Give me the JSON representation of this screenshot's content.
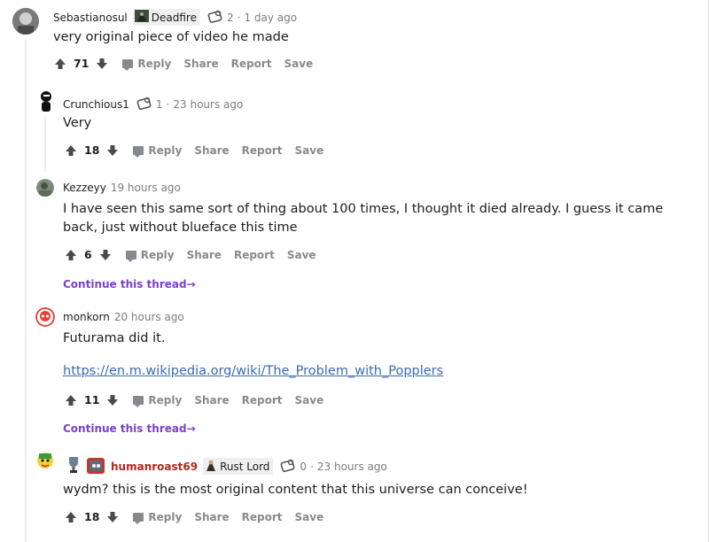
{
  "comments": [
    {
      "author": "Sebastianosul",
      "flair": "Deadfire",
      "award_count": "2",
      "time": "1 day ago",
      "body": "very original piece of video he made",
      "score": "71"
    },
    {
      "author": "Crunchious1",
      "award_count": "1",
      "time": "23 hours ago",
      "body": "Very",
      "score": "18"
    },
    {
      "author": "Kezzeyy",
      "time": "19 hours ago",
      "body": "I have seen this same sort of thing about 100 times, I thought it died already. I guess it came back, just without blueface this time",
      "score": "6",
      "continue": "Continue this thread"
    },
    {
      "author": "monkorn",
      "time": "20 hours ago",
      "body": "Futurama did it.",
      "link": "https://en.m.wikipedia.org/wiki/The_Problem_with_Popplers",
      "score": "11",
      "continue": "Continue this thread"
    },
    {
      "author": "humanroast69",
      "flair": "Rust Lord",
      "award_count": "0",
      "time": "23 hours ago",
      "body": "wydm? this is the most original content that this universe can conceive!",
      "score": "18"
    }
  ],
  "actions": {
    "reply": "Reply",
    "share": "Share",
    "report": "Report",
    "save": "Save"
  },
  "separator": "·",
  "continue_arrow": "→",
  "colors": {
    "op_author": "#b3261e",
    "continue_link": "#7b3fd0",
    "link": "#3a6ab8",
    "action_gray": "#878a8c"
  }
}
